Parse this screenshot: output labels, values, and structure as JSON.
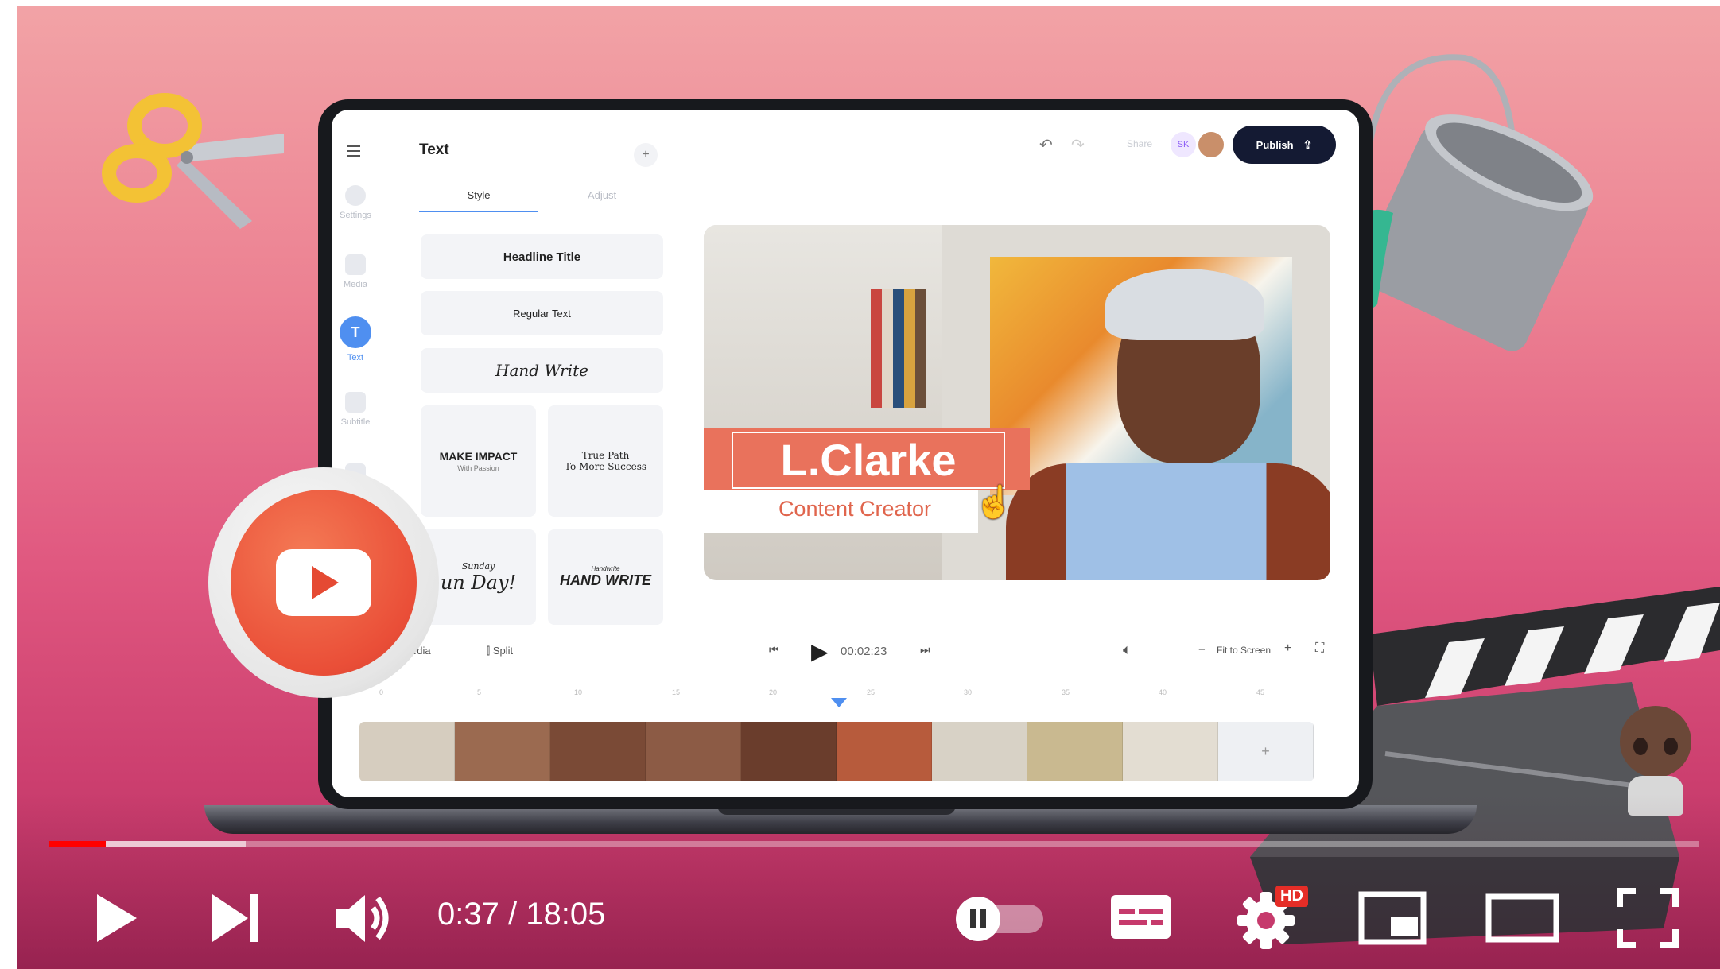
{
  "player": {
    "time_current": "0:37",
    "time_separator": "/",
    "time_total": "18:05",
    "progress_played_fraction": 0.034,
    "progress_buffered_fraction": 0.119,
    "hd_badge": "HD",
    "icons": [
      "play-icon",
      "next-icon",
      "volume-icon",
      "autoplay-toggle-icon",
      "subtitles-icon",
      "settings-icon",
      "miniplayer-icon",
      "theater-icon",
      "fullscreen-icon"
    ],
    "accent_color": "#ff0000"
  },
  "editor": {
    "panel_title": "Text",
    "add_label": "+",
    "tabs": [
      "Style",
      "Adjust"
    ],
    "active_tab": "Style",
    "rail": [
      {
        "label": "Settings"
      },
      {
        "label": "Media"
      },
      {
        "label": "Text",
        "glyph": "T"
      },
      {
        "label": "Subtitle"
      },
      {
        "label": ""
      }
    ],
    "styles": {
      "headline": "Headline Title",
      "regular": "Regular Text",
      "handwrite": "Hand Write",
      "impact_title": "MAKE IMPACT",
      "impact_sub": "With Passion",
      "path_line1": "True Path",
      "path_line2": "To More Success",
      "sunday_small": "Sunday",
      "sunday_big": "un Day!",
      "hand_small": "Handwrite",
      "hand_big": "HAND WRITE"
    },
    "topbar": {
      "share": "Share",
      "avatar_initials": "SK",
      "publish": "Publish"
    },
    "preview": {
      "name": "L.Clarke",
      "role": "Content Creator"
    },
    "timeline": {
      "media": "edia",
      "split": "Split",
      "time": "00:02:23",
      "fit": "Fit to Screen",
      "minus": "−",
      "plus": "+",
      "ticks": [
        "0",
        "5",
        "10",
        "15",
        "20",
        "25",
        "30",
        "35",
        "40",
        "45"
      ]
    }
  }
}
